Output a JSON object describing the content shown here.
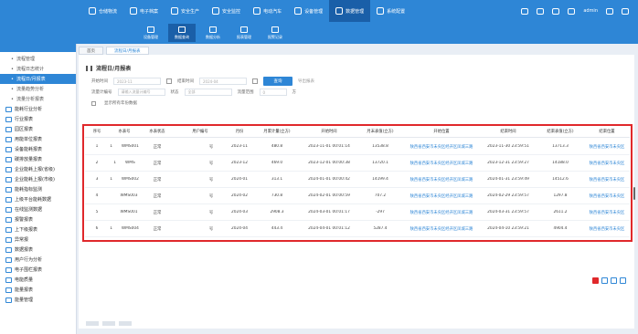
{
  "topnav": [
    {
      "label": "仓储物流",
      "icon": "warehouse-icon",
      "active": false
    },
    {
      "label": "电子档案",
      "icon": "archive-icon",
      "active": false
    },
    {
      "label": "安全生产",
      "icon": "safety-icon",
      "active": false
    },
    {
      "label": "安全监控",
      "icon": "monitor-icon",
      "active": false
    },
    {
      "label": "电动汽车",
      "icon": "ev-icon",
      "active": false
    },
    {
      "label": "设备管理",
      "icon": "device-icon",
      "active": false
    },
    {
      "label": "数据管理",
      "icon": "data-icon",
      "active": true
    },
    {
      "label": "系统配置",
      "icon": "system-icon",
      "active": false
    }
  ],
  "topright": {
    "user": "admin"
  },
  "subtools": [
    {
      "label": "设备管理",
      "active": false
    },
    {
      "label": "数据查询",
      "active": true
    },
    {
      "label": "数据分析",
      "active": false
    },
    {
      "label": "报表管理",
      "active": false
    },
    {
      "label": "报警记录",
      "active": false
    }
  ],
  "sidebar": [
    {
      "label": "流程管理",
      "type": "sub",
      "active": false
    },
    {
      "label": "流程日志统计",
      "type": "sub",
      "active": false
    },
    {
      "label": "流程日/月报表",
      "type": "sub",
      "active": true
    },
    {
      "label": "流量趋势分析",
      "type": "sub",
      "active": false
    },
    {
      "label": "流量分析报表",
      "type": "sub",
      "active": false
    },
    {
      "label": "能耗行业分析",
      "type": "main",
      "active": false
    },
    {
      "label": "行业报表",
      "type": "main",
      "active": false
    },
    {
      "label": "园区报表",
      "type": "main",
      "active": false
    },
    {
      "label": "用能单位报表",
      "type": "main",
      "active": false
    },
    {
      "label": "设备能耗报表",
      "type": "main",
      "active": false
    },
    {
      "label": "碳排放量报表",
      "type": "main",
      "active": false
    },
    {
      "label": "企业能耗上报(省级)",
      "type": "main",
      "active": false
    },
    {
      "label": "企业能耗上报(市级)",
      "type": "main",
      "active": false
    },
    {
      "label": "能耗指标监测",
      "type": "main",
      "active": false
    },
    {
      "label": "上级平台能耗数据",
      "type": "main",
      "active": false
    },
    {
      "label": "在线监测数据",
      "type": "main",
      "active": false
    },
    {
      "label": "报警报表",
      "type": "main",
      "active": false
    },
    {
      "label": "上下级报表",
      "type": "main",
      "active": false
    },
    {
      "label": "异常报",
      "type": "main",
      "active": false
    },
    {
      "label": "数据报表",
      "type": "main",
      "active": false
    },
    {
      "label": "用户行为分析",
      "type": "main",
      "active": false
    },
    {
      "label": "电子围栏报表",
      "type": "main",
      "active": false
    },
    {
      "label": "电能质量",
      "type": "main",
      "active": false
    },
    {
      "label": "能量报表",
      "type": "main",
      "active": false
    },
    {
      "label": "能量管理",
      "type": "main",
      "active": false
    }
  ],
  "tabs": [
    {
      "label": "首页",
      "active": false
    },
    {
      "label": "流程日/月报表",
      "active": true
    }
  ],
  "page": {
    "title": "流程日/月报表"
  },
  "filters": {
    "row1": {
      "label1": "开始时间",
      "v1": "2023-11",
      "label2": "结束时间",
      "v2": "2024-04",
      "query": "查询",
      "export": "导出报表"
    },
    "row2": {
      "label1": "流量计编号",
      "v1": "请输入流量计编号",
      "label2": "状态",
      "v2": "全部",
      "label3": "流量范围",
      "v3": "0",
      "unit": "方"
    },
    "checkbox": "显示所有年份数据"
  },
  "table": {
    "headers": [
      "序号",
      "水表号",
      "水表状态",
      "用户编号",
      "月份",
      "月累计量(立方)",
      "开始时间",
      "月末表值(立方)",
      "开始位置",
      "结束时间",
      "结束表值(立方)",
      "结束位置"
    ],
    "rows": [
      [
        "1",
        "1",
        "WMS001",
        "正常",
        "号",
        "2023-11",
        "480.8",
        "2023-11-01 00:01:14",
        "13538.8",
        "陕西省西安市未央区经开区凤城三路",
        "2023-11-30 23:59:51",
        "13713.3",
        "陕西省西安市未央区"
      ],
      [
        "2",
        "1",
        "WMS",
        "正常",
        "号",
        "2023-12",
        "469.0",
        "2023-12-01 00:00:38",
        "13720.1",
        "陕西省西安市未央区经开区凤城三路",
        "2023-12-31 23:59:27",
        "14188.0",
        "陕西省西安市未央区"
      ],
      [
        "3",
        "1",
        "WMS002",
        "正常",
        "号",
        "2024-01",
        "313.1",
        "2024-01-01 00:00:42",
        "14199.4",
        "陕西省西安市未央区经开区凤城三路",
        "2024-01-31 23:59:49",
        "14512.6",
        "陕西省西安市未央区"
      ],
      [
        "4",
        "",
        "WMS003",
        "正常",
        "号",
        "2024-02",
        "730.8",
        "2024-02-01 00:00:59",
        "707.2",
        "陕西省西安市未央区经开区凤城三路",
        "2024-02-29 23:59:57",
        "1297.8",
        "陕西省西安市未央区"
      ],
      [
        "5",
        "",
        "WMS001",
        "正常",
        "号",
        "2024-03",
        "2908.3",
        "2024-03-01 00:01:17",
        "-297",
        "陕西省西安市未央区经开区凤城三路",
        "2024-03-31 23:59:57",
        "2611.2",
        "陕西省西安市未央区"
      ],
      [
        "6",
        "1",
        "WMS004",
        "正常",
        "号",
        "2024-04",
        "443.4",
        "2024-04-01 00:01:12",
        "5287.4",
        "陕西省西安市未央区经开区凤城三路",
        "2024-04-10 23:59:21",
        "4904.4",
        "陕西省西安市未央区"
      ]
    ]
  },
  "colors": {
    "primary": "#2e86d6",
    "primaryDark": "#1a5fa8",
    "highlight": "#e0282b"
  }
}
